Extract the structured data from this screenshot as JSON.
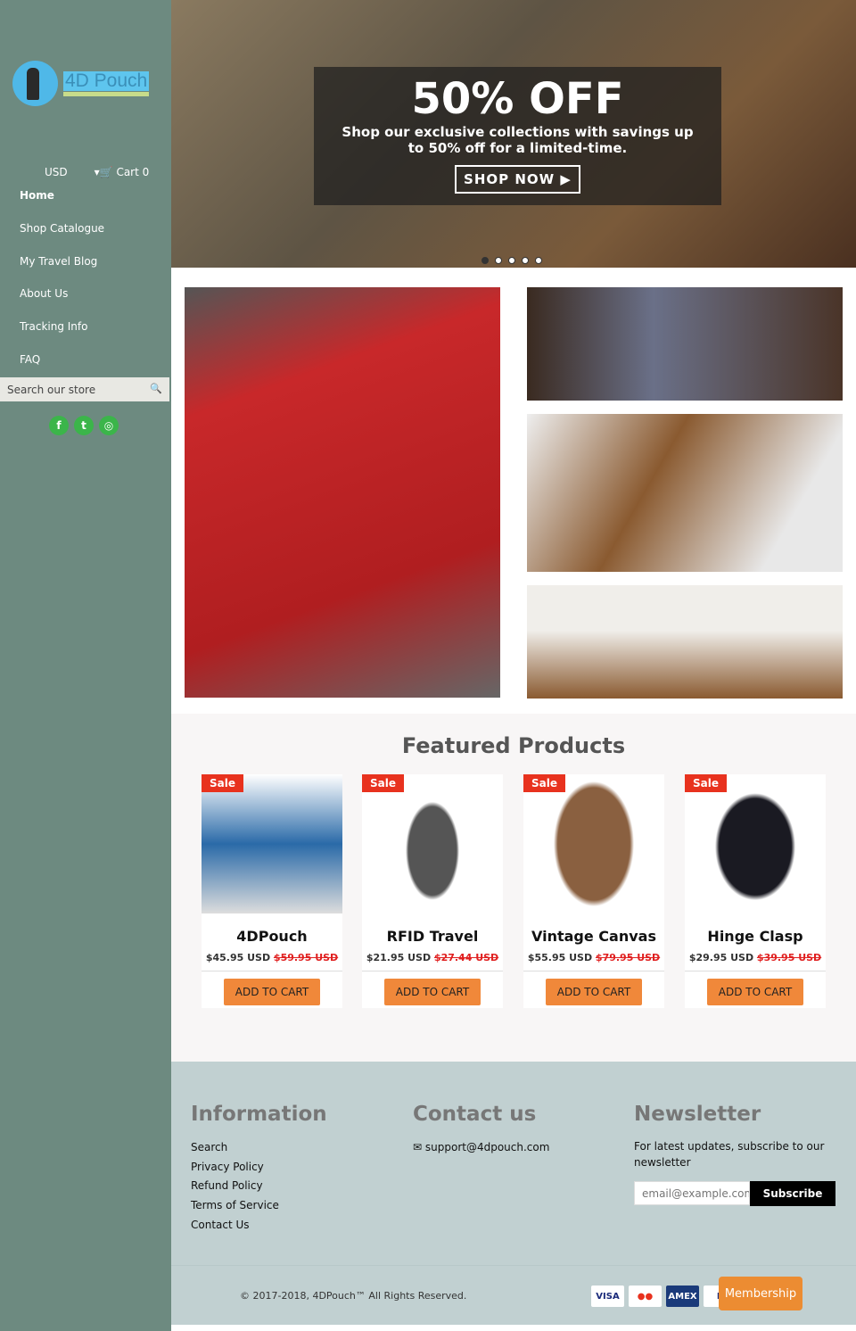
{
  "sidebar": {
    "logo_text": "4D Pouch",
    "currency": "USD",
    "cart": "Cart 0",
    "nav": [
      "Home",
      "Shop Catalogue",
      "My Travel Blog",
      "About Us",
      "Tracking Info",
      "FAQ"
    ],
    "search_placeholder": "Search our store",
    "social": [
      "facebook-icon",
      "twitter-icon",
      "instagram-icon"
    ]
  },
  "hero": {
    "title": "50% OFF",
    "subtitle": "Shop our exclusive collections with savings up to 50% off for a limited-time.",
    "cta": "SHOP NOW",
    "slides": 5,
    "active_slide": 1
  },
  "featured": {
    "title": "Featured Products",
    "badge": "Sale",
    "add_to_cart": "ADD TO CART",
    "products": [
      {
        "name": "4DPouch",
        "price": "$45.95 USD",
        "old_price": "$59.95 USD"
      },
      {
        "name": "RFID Travel",
        "price": "$21.95 USD",
        "old_price": "$27.44 USD"
      },
      {
        "name": "Vintage Canvas",
        "price": "$55.95 USD",
        "old_price": "$79.95 USD"
      },
      {
        "name": "Hinge Clasp",
        "price": "$29.95 USD",
        "old_price": "$39.95 USD"
      }
    ]
  },
  "footer": {
    "info_title": "Information",
    "info_links": [
      "Search",
      "Privacy Policy",
      "Refund Policy",
      "Terms of Service",
      "Contact Us"
    ],
    "contact_title": "Contact us",
    "email": "support@4dpouch.com",
    "newsletter_title": "Newsletter",
    "newsletter_text": "For latest updates, subscribe to our newsletter",
    "email_placeholder": "email@example.com",
    "subscribe": "Subscribe",
    "copyright": "© 2017-2018, 4DPouch™ All Rights Reserved.",
    "payments": [
      "VISA",
      "MC",
      "AMEX",
      "P"
    ],
    "membership": "Membership"
  },
  "colors": {
    "sidebar": "#6d8a80",
    "accent": "#f0883a",
    "sale": "#e8321e",
    "footer": "#c1d0d1"
  }
}
